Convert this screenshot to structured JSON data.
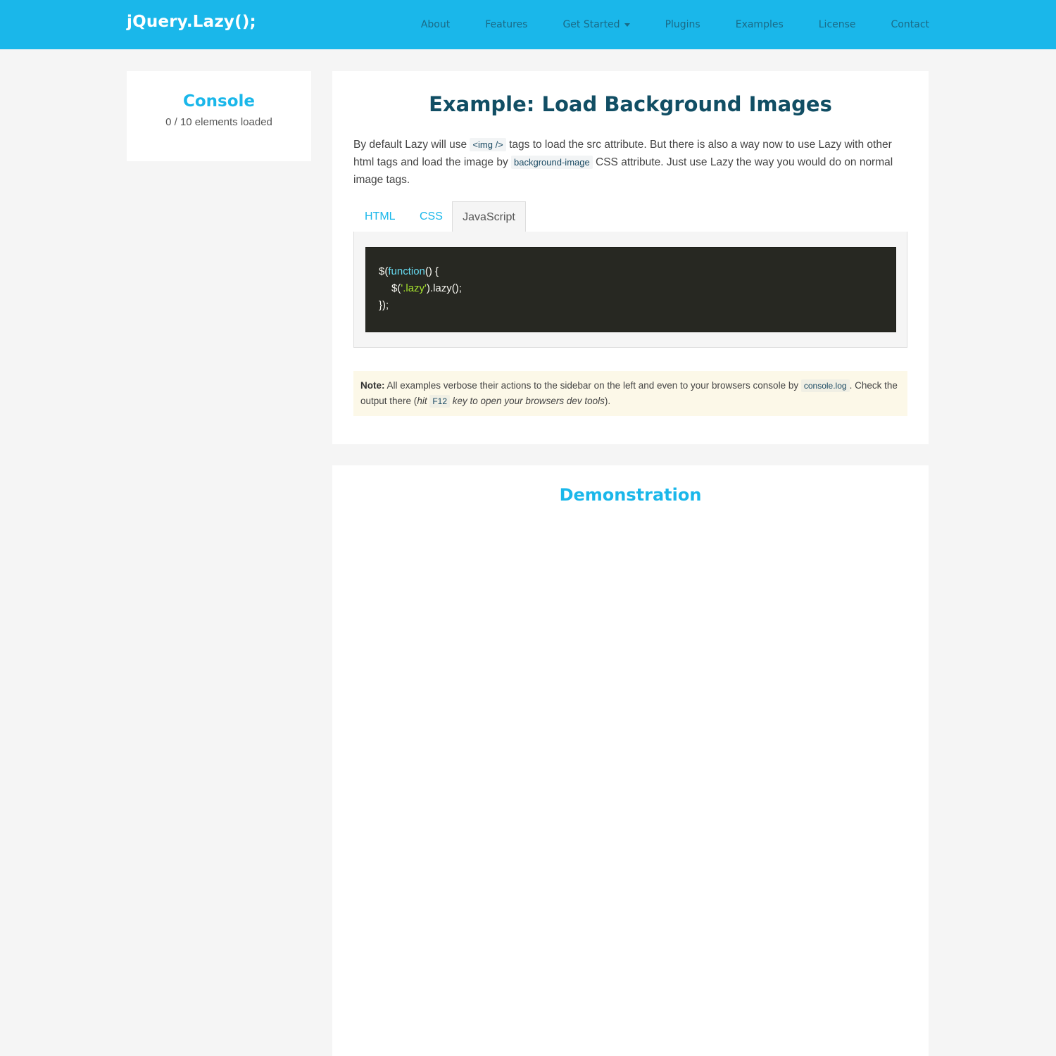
{
  "header": {
    "brand": "jQuery.Lazy();",
    "nav": [
      "About",
      "Features",
      "Get Started",
      "Plugins",
      "Examples",
      "License",
      "Contact"
    ]
  },
  "console": {
    "title": "Console",
    "status": "0 / 10 elements loaded"
  },
  "example": {
    "title": "Example: Load Background Images",
    "desc_1": "By default Lazy will use ",
    "desc_code_1": "<img />",
    "desc_2": " tags to load the src attribute. But there is also a way now to use Lazy with other html tags and load the image by ",
    "desc_code_2": "background-image",
    "desc_3": " CSS attribute. Just use Lazy the way you would do on normal image tags.",
    "tabs": [
      "HTML",
      "CSS",
      "JavaScript"
    ],
    "code": {
      "line1_a": "$(",
      "line1_kw": "function",
      "line1_b": "() {",
      "line2_a": "$(",
      "line2_str": "'.lazy'",
      "line2_b": ").lazy();",
      "line3": "});"
    }
  },
  "note": {
    "label": "Note:",
    "text_1": " All examples verbose their actions to the sidebar on the left and even to your browsers console by ",
    "code_1": "console.log",
    "text_2": ". Check the output there (",
    "italic_1": "hit ",
    "code_2": "F12",
    "italic_2": " key to open your browsers dev tools",
    "text_3": ")."
  },
  "demo": {
    "title": "Demonstration"
  },
  "colors": {
    "accent": "#1ab7ea",
    "title_dark": "#114e64",
    "nav_text": "#1a6a86",
    "code_bg": "#272822",
    "note_bg": "#fcf8e8"
  }
}
